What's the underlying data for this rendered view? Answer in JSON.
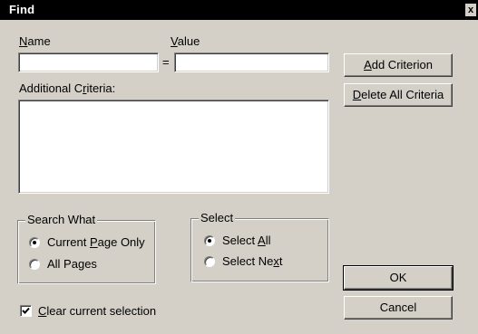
{
  "window": {
    "title": "Find",
    "close_glyph": "x"
  },
  "fields": {
    "name": {
      "label": "Name",
      "value": ""
    },
    "equals": "=",
    "value": {
      "label": "Value",
      "value": ""
    },
    "additional_criteria": {
      "label": "Additional Criteria:",
      "value": ""
    }
  },
  "buttons": {
    "add_criterion": "Add Criterion",
    "delete_all_criteria": "Delete All Criteria",
    "ok": "OK",
    "cancel": "Cancel"
  },
  "search_what": {
    "title": "Search What",
    "options": [
      {
        "label": "Current Page Only",
        "checked": true
      },
      {
        "label": "All Pages",
        "checked": false
      }
    ]
  },
  "select": {
    "title": "Select",
    "options": [
      {
        "label": "Select All",
        "checked": true
      },
      {
        "label": "Select Next",
        "checked": false
      }
    ]
  },
  "clear_selection": {
    "label": "Clear current selection",
    "checked": true
  }
}
